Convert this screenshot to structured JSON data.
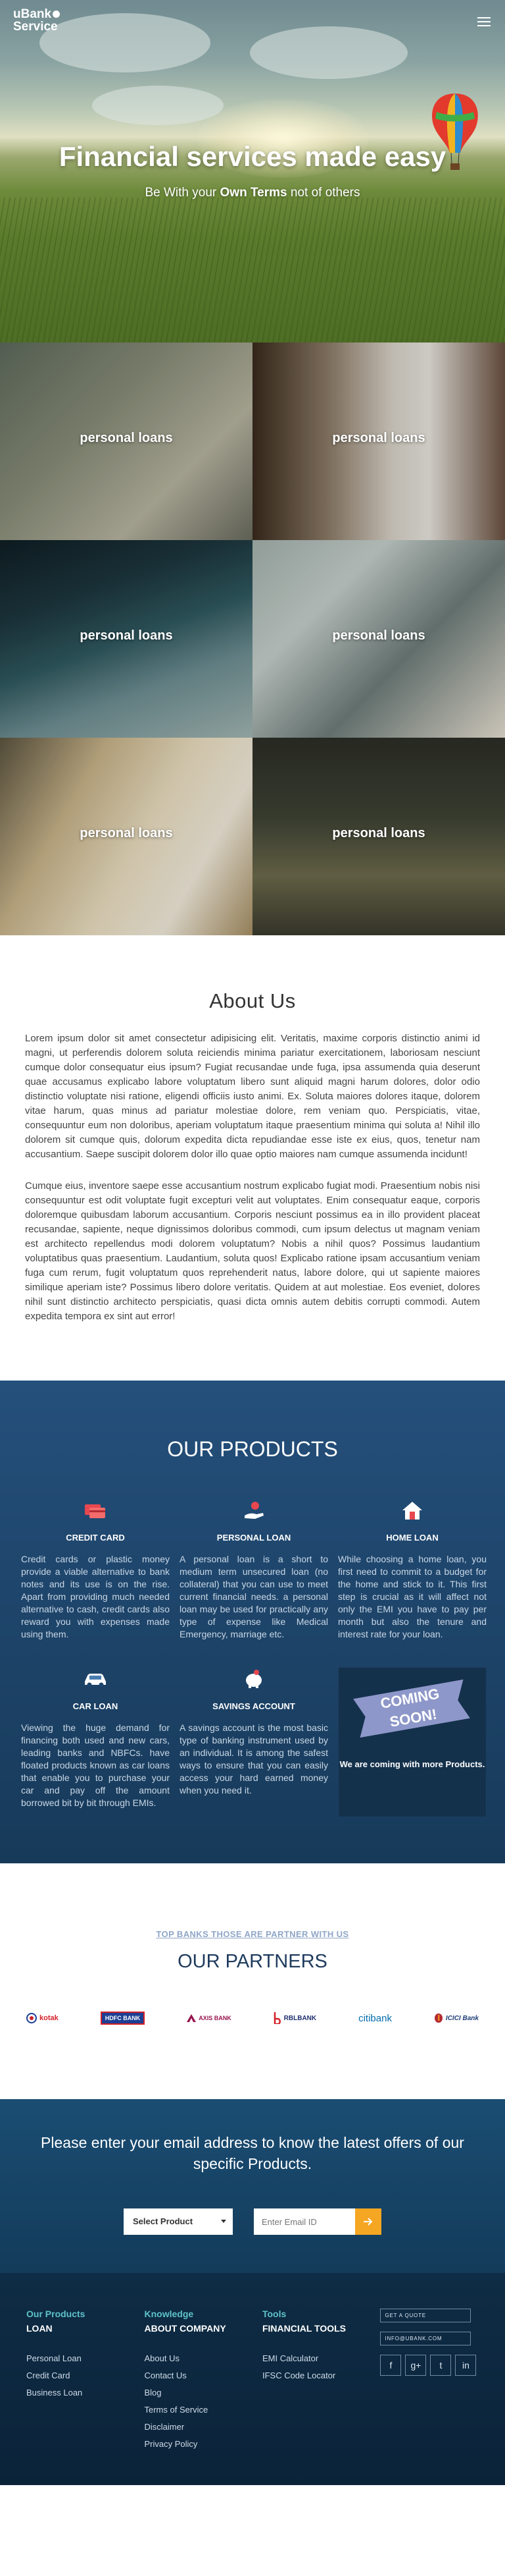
{
  "brand": {
    "name_line1": "uBank",
    "name_line2": "Service"
  },
  "hero": {
    "title": "Financial services made easy",
    "subtitle_pre": "Be With your",
    "subtitle_bold": "Own Terms",
    "subtitle_post": "not of others"
  },
  "tiles": [
    {
      "label": "personal loans"
    },
    {
      "label": "personal loans"
    },
    {
      "label": "personal loans"
    },
    {
      "label": "personal loans"
    },
    {
      "label": "personal loans"
    },
    {
      "label": "personal loans"
    }
  ],
  "about": {
    "title": "About Us",
    "paragraphs": [
      "Lorem ipsum dolor sit amet consectetur adipisicing elit. Veritatis, maxime corporis distinctio animi id magni, ut perferendis dolorem soluta reiciendis minima pariatur exercitationem, laboriosam nesciunt cumque dolor consequatur eius ipsum? Fugiat recusandae unde fuga, ipsa assumenda quia deserunt quae accusamus explicabo labore voluptatum libero sunt aliquid magni harum dolores, dolor odio distinctio voluptate nisi ratione, eligendi officiis iusto animi. Ex. Soluta maiores dolores itaque, dolorem vitae harum, quas minus ad pariatur molestiae dolore, rem veniam quo. Perspiciatis, vitae, consequuntur eum non doloribus, aperiam voluptatum itaque praesentium minima qui soluta a! Nihil illo dolorem sit cumque quis, dolorum expedita dicta repudiandae esse iste ex eius, quos, tenetur nam accusantium. Saepe suscipit dolorem dolor illo quae optio maiores nam cumque assumenda incidunt!",
      "Cumque eius, inventore saepe esse accusantium nostrum explicabo fugiat modi. Praesentium nobis nisi consequuntur est odit voluptate fugit excepturi velit aut voluptates. Enim consequatur eaque, corporis doloremque quibusdam laborum accusantium. Corporis nesciunt possimus ea in illo provident placeat recusandae, sapiente, neque dignissimos doloribus commodi, cum ipsum delectus ut magnam veniam est architecto repellendus modi dolorem voluptatum? Nobis a nihil quos? Possimus laudantium voluptatibus quas praesentium. Laudantium, soluta quos! Explicabo ratione ipsam accusantium veniam fuga cum rerum, fugit voluptatum quos reprehenderit natus, labore dolore, qui ut sapiente maiores similique aperiam iste? Possimus libero dolore veritatis. Quidem at aut molestiae. Eos eveniet, dolores nihil sunt distinctio architecto perspiciatis, quasi dicta omnis autem debitis corrupti commodi. Autem expedita tempora ex sint aut error!"
    ]
  },
  "products": {
    "title": "OUR PRODUCTS",
    "items": [
      {
        "name": "CREDIT CARD",
        "icon": "credit-card-icon",
        "desc": "Credit cards or plastic money provide a viable alternative to bank notes and its use is on the rise. Apart from providing much needed alternative to cash, credit cards also reward you with expenses made using them."
      },
      {
        "name": "PERSONAL LOAN",
        "icon": "hand-coin-icon",
        "desc": "A personal loan is a short to medium term unsecured loan (no collateral) that you can use to meet current financial needs. a personal loan may be used for practically any type of expense like Medical Emergency, marriage etc."
      },
      {
        "name": "HOME LOAN",
        "icon": "house-icon",
        "desc": "While choosing a home loan, you first need to commit to a budget for the home and stick to it. This first step is crucial as it will affect not only the EMI you have to pay per month but also the tenure and interest rate for your loan."
      },
      {
        "name": "CAR LOAN",
        "icon": "car-icon",
        "desc": "Viewing the huge demand for financing both used and new cars, leading banks and NBFCs. have floated products known as car loans that enable you to purchase your car and pay off the amount borrowed bit by bit through EMIs."
      },
      {
        "name": "SAVINGS ACCOUNT",
        "icon": "piggy-bank-icon",
        "desc": "A savings account is the most basic type of banking instrument used by an individual. It is among the safest ways to ensure that you can easily access your hard earned money when you need it."
      }
    ],
    "coming": {
      "line1": "COMING",
      "line2": "SOON!",
      "note": "We are coming with more Products."
    },
    "colors": {
      "credit": "#e8474f",
      "personal": "#e8474f",
      "home": "#e8474f"
    }
  },
  "partners": {
    "kicker": "TOP BANKS THOSE ARE PARTNER WITH US",
    "title": "OUR PARTNERS",
    "banks": [
      {
        "name": "kotak",
        "color": "#d32028"
      },
      {
        "name": "HDFC BANK",
        "color": "#1c3f94"
      },
      {
        "name": "AXIS BANK",
        "color": "#97144d"
      },
      {
        "name": "RBLBANK",
        "color": "#1e2f6e"
      },
      {
        "name": "citibank",
        "color": "#056dae"
      },
      {
        "name": "ICICI Bank",
        "color": "#1f3e76"
      }
    ]
  },
  "subscribe": {
    "title": "Please enter your email address to know the latest offers of our specific Products.",
    "select_label": "Select Product",
    "email_placeholder": "Enter Email ID"
  },
  "footer": {
    "cols": [
      {
        "kicker": "Our Products",
        "heading": "LOAN",
        "links": [
          "Personal Loan",
          "Credit Card",
          "Business Loan"
        ]
      },
      {
        "kicker": "Knowledge",
        "heading": "ABOUT COMPANY",
        "links": [
          "About Us",
          "Contact Us",
          "Blog",
          "Terms of Service",
          "Disclaimer",
          "Privacy Policy"
        ]
      },
      {
        "kicker": "Tools",
        "heading": "FINANCIAL TOOLS",
        "links": [
          "EMI Calculator",
          "IFSC Code Locator"
        ]
      }
    ],
    "quote_btn": "GET A QUOTE",
    "email_btn": "INFO@UBANK.COM",
    "socials": [
      "f",
      "g+",
      "t",
      "in"
    ]
  }
}
